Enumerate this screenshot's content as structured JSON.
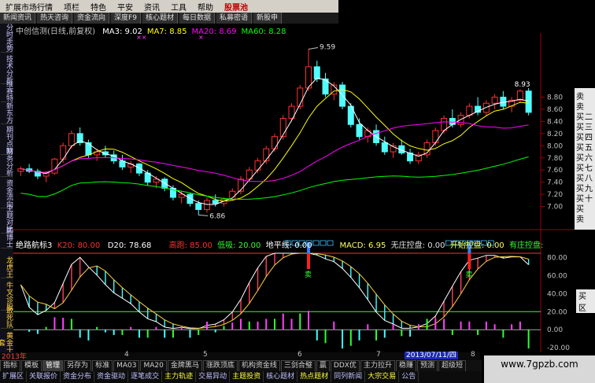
{
  "menu": {
    "items": [
      "扩展市场行情",
      "项栏",
      "特色",
      "平安",
      "资讯",
      "工具",
      "帮助"
    ],
    "hot": "股票池"
  },
  "toptabs": [
    "新闻资讯",
    "热天咨询",
    "资金流向",
    "深度F9",
    "核心题材",
    "每日数据",
    "私募密语",
    "新股申"
  ],
  "vtabs": [
    "分时走势",
    "技术分析",
    "维赛特",
    "新东方",
    "期刊点睛",
    "财务分析",
    "资金流向",
    "主题对比",
    "鹏博士"
  ],
  "chart_title": "中创信测(日线,前复权)",
  "ma": [
    {
      "name": "MA3: 9.02",
      "color": "#ffffff"
    },
    {
      "name": "MA7: 8.85",
      "color": "#ffff00"
    },
    {
      "name": "MA20: 8.69",
      "color": "#ff00ff"
    },
    {
      "name": "MA60: 8.28",
      "color": "#00ff00"
    }
  ],
  "price_axis": [
    "8.80",
    "8.60",
    "8.40",
    "8.20",
    "8.00",
    "7.80",
    "7.60",
    "7.40",
    "7.20",
    "7.00"
  ],
  "high_label": "9.59",
  "low_label": "6.86",
  "last_label": "8.93",
  "right_panel": [
    "卖",
    "卖",
    "买",
    "买",
    "买",
    "买",
    "买",
    "买",
    "买",
    "买",
    "买",
    "买",
    "卖"
  ],
  "right_panel2": [
    "二",
    "三",
    "四",
    "五",
    "六",
    "七",
    "八",
    "九",
    "十"
  ],
  "ind": {
    "name": "绝路航标3",
    "k": "K20: 80.00",
    "d": "D20: 78.68",
    "top": "高跑: 85.00",
    "low": "低吸: 20.00",
    "flat": "地平线: 0.00",
    "macd": "MACD: 6.95",
    "nz": "无庄控盘: 0.00",
    "kz": "开始控盘: 0.00",
    "yz": "有庄控盘:"
  },
  "ind_axis": [
    "80.00",
    "60.00",
    "40.00",
    "20.00",
    "0.00",
    "-20.00"
  ],
  "ind_vtabs": [
    "龙虎王",
    "牛叉诊股",
    "敢死队",
    "黄金十套",
    "买区"
  ],
  "sell_label": "卖",
  "datebar": {
    "year": "2013年",
    "marks": [
      "4",
      "5",
      "6",
      "7",
      "8"
    ],
    "date": "2013/07/11/四"
  },
  "btabs1": [
    "指标",
    "模板",
    "管理",
    "另存为",
    "标准",
    "MA03",
    "MA20",
    "金牌黑马",
    "涨跌顶底",
    "机构资金线",
    "三剑合璧",
    "赢",
    "DDX优",
    "主力拉升",
    "稳赚",
    "预测",
    "超级短"
  ],
  "btabs2": [
    "扩展区",
    "关联报价",
    "资金分布",
    "资金驱动",
    "逐笔成交",
    "主力轨迹",
    "交易异动",
    "主题投资",
    "核心题材",
    "热点题材",
    "同列新闻",
    "大宗交易",
    "公告"
  ],
  "watermark": "www.7gpzb.com",
  "chart_data": {
    "type": "candlestick",
    "title": "中创信测(日线,前复权)",
    "ylim": [
      6.8,
      9.7
    ],
    "candles": [
      [
        7.58,
        7.66,
        7.5,
        7.62
      ],
      [
        7.62,
        7.7,
        7.55,
        7.58
      ],
      [
        7.58,
        7.62,
        7.45,
        7.5
      ],
      [
        7.5,
        7.58,
        7.4,
        7.55
      ],
      [
        7.55,
        7.8,
        7.52,
        7.78
      ],
      [
        7.78,
        8.05,
        7.72,
        8.0
      ],
      [
        8.0,
        8.25,
        7.95,
        8.2
      ],
      [
        8.2,
        8.3,
        8.0,
        8.05
      ],
      [
        8.05,
        8.1,
        7.8,
        7.85
      ],
      [
        7.85,
        7.95,
        7.75,
        7.9
      ],
      [
        7.9,
        8.0,
        7.8,
        7.85
      ],
      [
        7.85,
        7.92,
        7.7,
        7.75
      ],
      [
        7.75,
        7.85,
        7.6,
        7.65
      ],
      [
        7.65,
        7.75,
        7.55,
        7.7
      ],
      [
        7.7,
        7.72,
        7.5,
        7.55
      ],
      [
        7.55,
        7.6,
        7.35,
        7.4
      ],
      [
        7.4,
        7.5,
        7.3,
        7.45
      ],
      [
        7.45,
        7.48,
        7.25,
        7.3
      ],
      [
        7.3,
        7.35,
        7.1,
        7.15
      ],
      [
        7.15,
        7.25,
        7.05,
        7.2
      ],
      [
        7.2,
        7.22,
        7.0,
        7.05
      ],
      [
        7.05,
        7.1,
        6.86,
        6.95
      ],
      [
        6.95,
        7.15,
        6.9,
        7.1
      ],
      [
        7.1,
        7.2,
        7.0,
        7.05
      ],
      [
        7.05,
        7.15,
        7.0,
        7.12
      ],
      [
        7.12,
        7.3,
        7.1,
        7.25
      ],
      [
        7.25,
        7.5,
        7.2,
        7.45
      ],
      [
        7.45,
        7.65,
        7.4,
        7.6
      ],
      [
        7.6,
        7.8,
        7.55,
        7.75
      ],
      [
        7.75,
        8.0,
        7.7,
        7.95
      ],
      [
        7.95,
        8.2,
        7.9,
        8.15
      ],
      [
        8.15,
        8.5,
        8.1,
        8.45
      ],
      [
        8.45,
        8.7,
        8.4,
        8.65
      ],
      [
        8.65,
        9.0,
        8.6,
        8.95
      ],
      [
        8.95,
        9.59,
        8.9,
        9.3
      ],
      [
        9.3,
        9.4,
        9.05,
        9.1
      ],
      [
        9.1,
        9.2,
        8.8,
        8.85
      ],
      [
        8.85,
        9.05,
        8.75,
        9.0
      ],
      [
        9.0,
        9.05,
        8.6,
        8.65
      ],
      [
        8.65,
        8.7,
        8.3,
        8.35
      ],
      [
        8.35,
        8.45,
        8.1,
        8.15
      ],
      [
        8.15,
        8.3,
        8.05,
        8.25
      ],
      [
        8.25,
        8.35,
        8.0,
        8.05
      ],
      [
        8.05,
        8.15,
        7.85,
        7.9
      ],
      [
        7.9,
        8.05,
        7.8,
        8.0
      ],
      [
        8.0,
        8.1,
        7.85,
        7.88
      ],
      [
        7.88,
        7.95,
        7.7,
        7.75
      ],
      [
        7.75,
        7.9,
        7.7,
        7.85
      ],
      [
        7.85,
        8.1,
        7.8,
        8.05
      ],
      [
        8.05,
        8.3,
        8.0,
        8.25
      ],
      [
        8.25,
        8.5,
        8.2,
        8.45
      ],
      [
        8.45,
        8.6,
        8.3,
        8.35
      ],
      [
        8.35,
        8.55,
        8.3,
        8.5
      ],
      [
        8.5,
        8.7,
        8.45,
        8.65
      ],
      [
        8.65,
        8.8,
        8.5,
        8.55
      ],
      [
        8.55,
        8.75,
        8.5,
        8.7
      ],
      [
        8.7,
        8.85,
        8.6,
        8.8
      ],
      [
        8.8,
        8.9,
        8.6,
        8.65
      ],
      [
        8.65,
        8.8,
        8.55,
        8.75
      ],
      [
        8.75,
        8.93,
        8.7,
        8.9
      ],
      [
        8.9,
        8.95,
        8.5,
        8.55
      ]
    ]
  }
}
